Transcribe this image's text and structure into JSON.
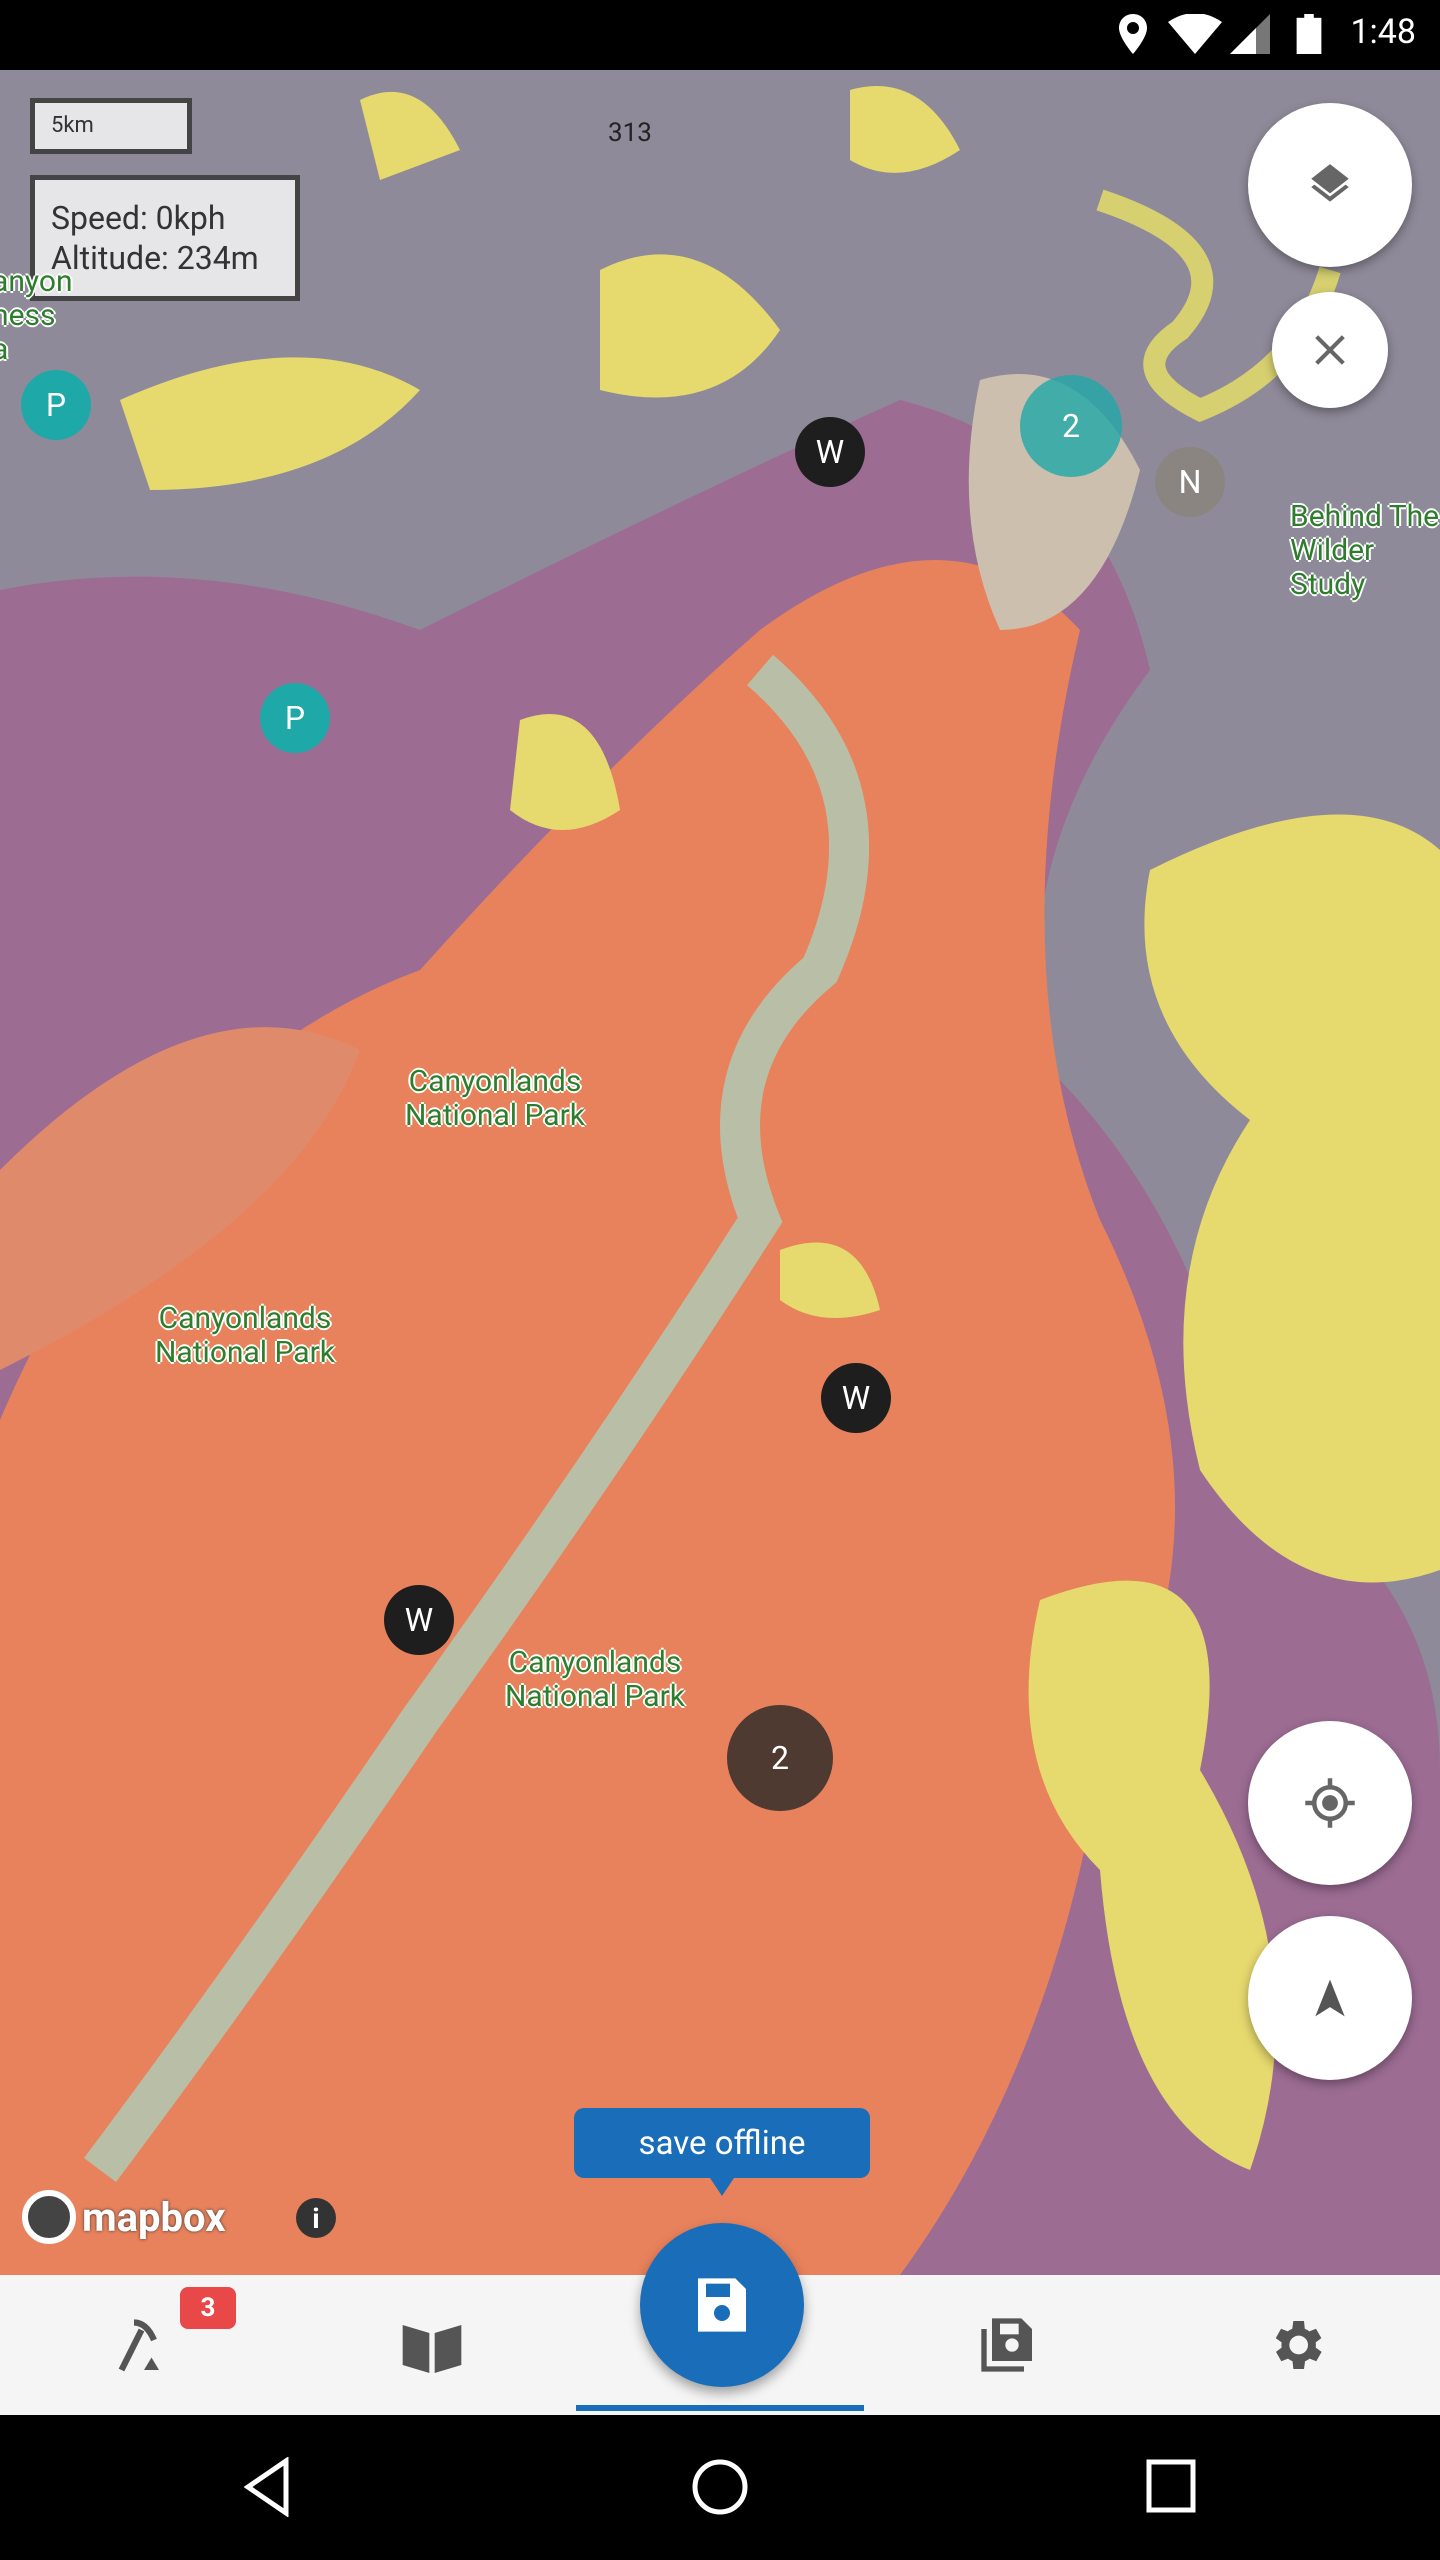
{
  "status_bar": {
    "time": "1:48",
    "icons": [
      "location-icon",
      "wifi-icon",
      "signal-icon",
      "battery-icon"
    ]
  },
  "map": {
    "scale_label": "5km",
    "speed": "Speed: 0kph",
    "altitude": "Altitude: 234m",
    "road_label": "313",
    "place_labels": [
      "Canyonlands National Park",
      "Canyonlands National Park",
      "Canyonlands National Park",
      "Behind The Wilder Study",
      "anyon ness a"
    ],
    "markers": [
      {
        "type": "waypoint",
        "label": "W"
      },
      {
        "type": "waypoint",
        "label": "W"
      },
      {
        "type": "waypoint",
        "label": "W"
      },
      {
        "type": "cluster",
        "label": "2"
      },
      {
        "type": "cluster",
        "label": "2"
      },
      {
        "type": "note",
        "label": "N"
      },
      {
        "type": "parking",
        "label": "P"
      },
      {
        "type": "parking",
        "label": "P"
      }
    ],
    "attribution": "mapbox",
    "colors": {
      "orange": "#e8825c",
      "yellow": "#e6d96e",
      "purple": "#9c6c93",
      "gray": "#8f8a99",
      "teal": "#1fa8a8"
    }
  },
  "tooltip": "save offline",
  "bottom_nav": {
    "badge": "3",
    "items": [
      "rock-hammer-icon",
      "book-icon",
      "save-icon",
      "saved-maps-icon",
      "settings-icon"
    ],
    "accent": "#1a6db8"
  }
}
